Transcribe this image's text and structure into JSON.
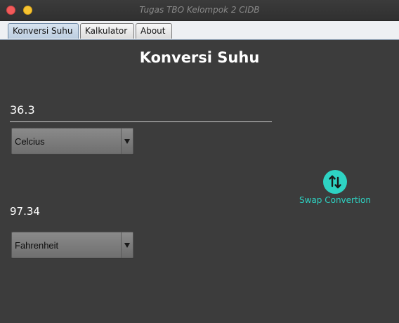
{
  "window": {
    "title": "Tugas TBO Kelompok 2 CIDB"
  },
  "tabs": [
    {
      "label": "Konversi Suhu",
      "active": true
    },
    {
      "label": "Kalkulator",
      "active": false
    },
    {
      "label": "About",
      "active": false
    }
  ],
  "main": {
    "title": "Konversi Suhu",
    "input_value": "36.3",
    "from_unit": "Celcius",
    "result_value": "97.34",
    "to_unit": "Fahrenheit",
    "swap_label": "Swap Convertion",
    "swap_icon": "swap-vertical-icon"
  },
  "colors": {
    "background": "#3c3c3c",
    "accent": "#2ed3c3",
    "close": "#f25a5a",
    "minimize": "#f7c331"
  }
}
